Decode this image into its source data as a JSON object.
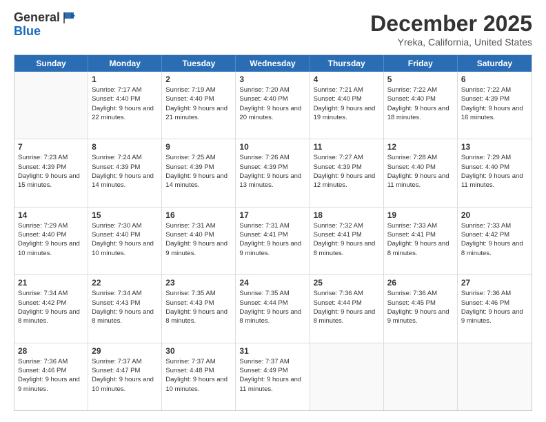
{
  "header": {
    "logo_general": "General",
    "logo_blue": "Blue",
    "title": "December 2025",
    "subtitle": "Yreka, California, United States"
  },
  "days": [
    "Sunday",
    "Monday",
    "Tuesday",
    "Wednesday",
    "Thursday",
    "Friday",
    "Saturday"
  ],
  "weeks": [
    [
      {
        "day": "",
        "sunrise": "",
        "sunset": "",
        "daylight": ""
      },
      {
        "day": "1",
        "sunrise": "Sunrise: 7:17 AM",
        "sunset": "Sunset: 4:40 PM",
        "daylight": "Daylight: 9 hours and 22 minutes."
      },
      {
        "day": "2",
        "sunrise": "Sunrise: 7:19 AM",
        "sunset": "Sunset: 4:40 PM",
        "daylight": "Daylight: 9 hours and 21 minutes."
      },
      {
        "day": "3",
        "sunrise": "Sunrise: 7:20 AM",
        "sunset": "Sunset: 4:40 PM",
        "daylight": "Daylight: 9 hours and 20 minutes."
      },
      {
        "day": "4",
        "sunrise": "Sunrise: 7:21 AM",
        "sunset": "Sunset: 4:40 PM",
        "daylight": "Daylight: 9 hours and 19 minutes."
      },
      {
        "day": "5",
        "sunrise": "Sunrise: 7:22 AM",
        "sunset": "Sunset: 4:40 PM",
        "daylight": "Daylight: 9 hours and 18 minutes."
      },
      {
        "day": "6",
        "sunrise": "Sunrise: 7:22 AM",
        "sunset": "Sunset: 4:39 PM",
        "daylight": "Daylight: 9 hours and 16 minutes."
      }
    ],
    [
      {
        "day": "7",
        "sunrise": "Sunrise: 7:23 AM",
        "sunset": "Sunset: 4:39 PM",
        "daylight": "Daylight: 9 hours and 15 minutes."
      },
      {
        "day": "8",
        "sunrise": "Sunrise: 7:24 AM",
        "sunset": "Sunset: 4:39 PM",
        "daylight": "Daylight: 9 hours and 14 minutes."
      },
      {
        "day": "9",
        "sunrise": "Sunrise: 7:25 AM",
        "sunset": "Sunset: 4:39 PM",
        "daylight": "Daylight: 9 hours and 14 minutes."
      },
      {
        "day": "10",
        "sunrise": "Sunrise: 7:26 AM",
        "sunset": "Sunset: 4:39 PM",
        "daylight": "Daylight: 9 hours and 13 minutes."
      },
      {
        "day": "11",
        "sunrise": "Sunrise: 7:27 AM",
        "sunset": "Sunset: 4:39 PM",
        "daylight": "Daylight: 9 hours and 12 minutes."
      },
      {
        "day": "12",
        "sunrise": "Sunrise: 7:28 AM",
        "sunset": "Sunset: 4:40 PM",
        "daylight": "Daylight: 9 hours and 11 minutes."
      },
      {
        "day": "13",
        "sunrise": "Sunrise: 7:29 AM",
        "sunset": "Sunset: 4:40 PM",
        "daylight": "Daylight: 9 hours and 11 minutes."
      }
    ],
    [
      {
        "day": "14",
        "sunrise": "Sunrise: 7:29 AM",
        "sunset": "Sunset: 4:40 PM",
        "daylight": "Daylight: 9 hours and 10 minutes."
      },
      {
        "day": "15",
        "sunrise": "Sunrise: 7:30 AM",
        "sunset": "Sunset: 4:40 PM",
        "daylight": "Daylight: 9 hours and 10 minutes."
      },
      {
        "day": "16",
        "sunrise": "Sunrise: 7:31 AM",
        "sunset": "Sunset: 4:40 PM",
        "daylight": "Daylight: 9 hours and 9 minutes."
      },
      {
        "day": "17",
        "sunrise": "Sunrise: 7:31 AM",
        "sunset": "Sunset: 4:41 PM",
        "daylight": "Daylight: 9 hours and 9 minutes."
      },
      {
        "day": "18",
        "sunrise": "Sunrise: 7:32 AM",
        "sunset": "Sunset: 4:41 PM",
        "daylight": "Daylight: 9 hours and 8 minutes."
      },
      {
        "day": "19",
        "sunrise": "Sunrise: 7:33 AM",
        "sunset": "Sunset: 4:41 PM",
        "daylight": "Daylight: 9 hours and 8 minutes."
      },
      {
        "day": "20",
        "sunrise": "Sunrise: 7:33 AM",
        "sunset": "Sunset: 4:42 PM",
        "daylight": "Daylight: 9 hours and 8 minutes."
      }
    ],
    [
      {
        "day": "21",
        "sunrise": "Sunrise: 7:34 AM",
        "sunset": "Sunset: 4:42 PM",
        "daylight": "Daylight: 9 hours and 8 minutes."
      },
      {
        "day": "22",
        "sunrise": "Sunrise: 7:34 AM",
        "sunset": "Sunset: 4:43 PM",
        "daylight": "Daylight: 9 hours and 8 minutes."
      },
      {
        "day": "23",
        "sunrise": "Sunrise: 7:35 AM",
        "sunset": "Sunset: 4:43 PM",
        "daylight": "Daylight: 9 hours and 8 minutes."
      },
      {
        "day": "24",
        "sunrise": "Sunrise: 7:35 AM",
        "sunset": "Sunset: 4:44 PM",
        "daylight": "Daylight: 9 hours and 8 minutes."
      },
      {
        "day": "25",
        "sunrise": "Sunrise: 7:36 AM",
        "sunset": "Sunset: 4:44 PM",
        "daylight": "Daylight: 9 hours and 8 minutes."
      },
      {
        "day": "26",
        "sunrise": "Sunrise: 7:36 AM",
        "sunset": "Sunset: 4:45 PM",
        "daylight": "Daylight: 9 hours and 9 minutes."
      },
      {
        "day": "27",
        "sunrise": "Sunrise: 7:36 AM",
        "sunset": "Sunset: 4:46 PM",
        "daylight": "Daylight: 9 hours and 9 minutes."
      }
    ],
    [
      {
        "day": "28",
        "sunrise": "Sunrise: 7:36 AM",
        "sunset": "Sunset: 4:46 PM",
        "daylight": "Daylight: 9 hours and 9 minutes."
      },
      {
        "day": "29",
        "sunrise": "Sunrise: 7:37 AM",
        "sunset": "Sunset: 4:47 PM",
        "daylight": "Daylight: 9 hours and 10 minutes."
      },
      {
        "day": "30",
        "sunrise": "Sunrise: 7:37 AM",
        "sunset": "Sunset: 4:48 PM",
        "daylight": "Daylight: 9 hours and 10 minutes."
      },
      {
        "day": "31",
        "sunrise": "Sunrise: 7:37 AM",
        "sunset": "Sunset: 4:49 PM",
        "daylight": "Daylight: 9 hours and 11 minutes."
      },
      {
        "day": "",
        "sunrise": "",
        "sunset": "",
        "daylight": ""
      },
      {
        "day": "",
        "sunrise": "",
        "sunset": "",
        "daylight": ""
      },
      {
        "day": "",
        "sunrise": "",
        "sunset": "",
        "daylight": ""
      }
    ]
  ]
}
